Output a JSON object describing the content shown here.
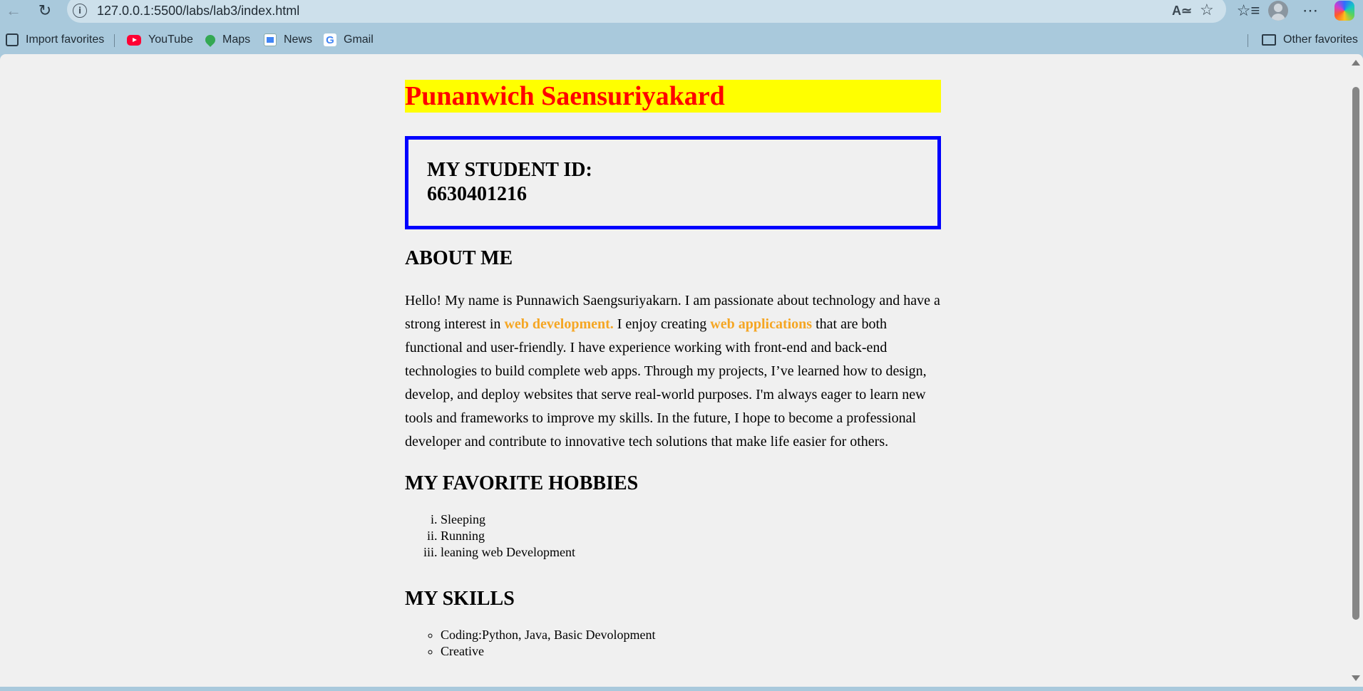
{
  "browser": {
    "url": "127.0.0.1:5500/labs/lab3/index.html",
    "bookmarks": [
      {
        "label": "Import favorites",
        "icon": "import-icon"
      },
      {
        "label": "YouTube",
        "icon": "youtube-icon"
      },
      {
        "label": "Maps",
        "icon": "maps-icon"
      },
      {
        "label": "News",
        "icon": "news-icon"
      },
      {
        "label": "Gmail",
        "icon": "gmail-icon"
      }
    ],
    "other_favorites": "Other favorites"
  },
  "page": {
    "name_heading": "Punanwich Saensuriyakard",
    "student_id_label": "MY STUDENT ID:",
    "student_id_value": "6630401216",
    "about": {
      "heading": "ABOUT ME",
      "text_1": "Hello! My name is Punnawich Saengsuriyakarn. I am passionate about technology and have a strong interest in ",
      "highlight_1": "web development.",
      "text_2": " I enjoy creating ",
      "highlight_2": "web applications",
      "text_3": " that are both functional and user-friendly. I have experience working with front-end and back-end technologies to build complete web apps. Through my projects, I’ve learned how to design, develop, and deploy websites that serve real-world purposes. I'm always eager to learn new tools and frameworks to improve my skills. In the future, I hope to become a professional developer and contribute to innovative tech solutions that make life easier for others."
    },
    "hobbies": {
      "heading": "MY FAVORITE HOBBIES",
      "items": [
        "Sleeping",
        "Running",
        "leaning web Development"
      ]
    },
    "skills": {
      "heading": "MY SKILLS",
      "items": [
        "Coding:Python, Java, Basic Devolopment",
        "Creative"
      ]
    }
  },
  "colors": {
    "name_bg": "#ffff00",
    "name_text": "#ff0000",
    "id_border": "#0000ff",
    "highlight": "#f5a623",
    "page_bg": "#f0f0f0",
    "chrome_bg": "#a9c9dc"
  }
}
